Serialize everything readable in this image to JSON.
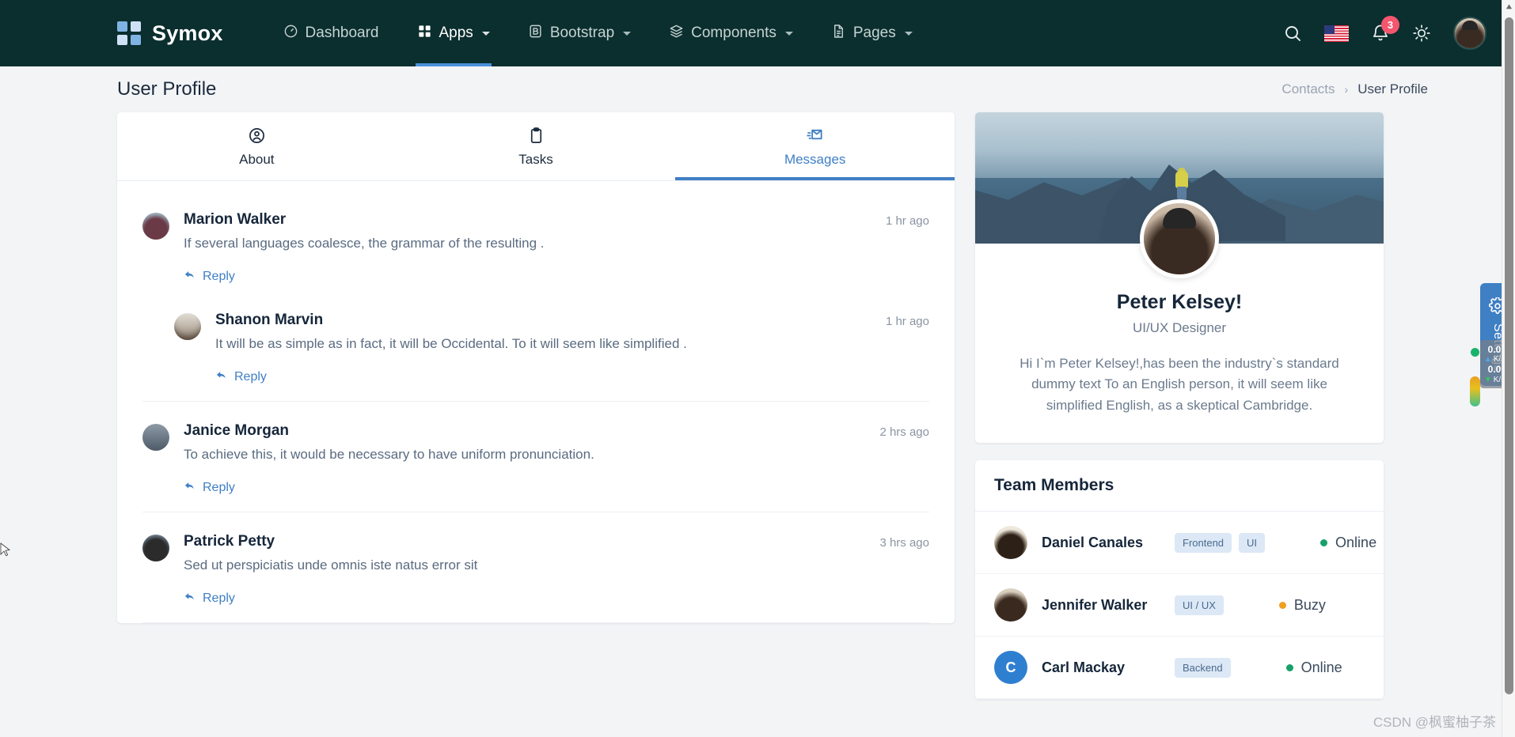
{
  "navbar": {
    "brand": "Symox",
    "links": [
      {
        "label": "Dashboard",
        "icon": "gauge-icon",
        "has_caret": false,
        "active": false
      },
      {
        "label": "Apps",
        "icon": "grid-icon",
        "has_caret": true,
        "active": true
      },
      {
        "label": "Bootstrap",
        "icon": "bootstrap-icon",
        "has_caret": true,
        "active": false
      },
      {
        "label": "Components",
        "icon": "layers-icon",
        "has_caret": true,
        "active": false
      },
      {
        "label": "Pages",
        "icon": "file-icon",
        "has_caret": true,
        "active": false
      }
    ],
    "search_icon": "search-icon",
    "language_flag": "us-flag-icon",
    "notifications_icon": "bell-icon",
    "notifications_count": "3",
    "theme_icon": "sun-icon",
    "avatar": "user-avatar"
  },
  "page": {
    "title": "User Profile",
    "breadcrumb": {
      "parent": "Contacts",
      "separator": "›",
      "current": "User Profile"
    }
  },
  "tabs": [
    {
      "label": "About",
      "icon": "user-circle-icon",
      "active": false
    },
    {
      "label": "Tasks",
      "icon": "clipboard-icon",
      "active": false
    },
    {
      "label": "Messages",
      "icon": "mail-send-icon",
      "active": true
    }
  ],
  "messages": [
    {
      "name": "Marion Walker",
      "time": "1 hr ago",
      "text": "If several languages coalesce, the grammar of the resulting .",
      "reply_label": "Reply",
      "nested": false
    },
    {
      "name": "Shanon Marvin",
      "time": "1 hr ago",
      "text": "It will be as simple as in fact, it will be Occidental. To it will seem like simplified .",
      "reply_label": "Reply",
      "nested": true
    },
    {
      "name": "Janice Morgan",
      "time": "2 hrs ago",
      "text": "To achieve this, it would be necessary to have uniform pronunciation.",
      "reply_label": "Reply",
      "nested": false
    },
    {
      "name": "Patrick Petty",
      "time": "3 hrs ago",
      "text": "Sed ut perspiciatis unde omnis iste natus error sit",
      "reply_label": "Reply",
      "nested": false
    }
  ],
  "profile": {
    "name": "Peter Kelsey!",
    "role": "UI/UX Designer",
    "bio": "Hi I`m Peter Kelsey!,has been the industry`s standard dummy text To an English person, it will seem like simplified English, as a skeptical Cambridge."
  },
  "team": {
    "title": "Team Members",
    "members": [
      {
        "name": "Daniel Canales",
        "tags": [
          "Frontend",
          "UI"
        ],
        "status": "Online",
        "status_color": "#18a06a",
        "initial": ""
      },
      {
        "name": "Jennifer Walker",
        "tags": [
          "UI / UX"
        ],
        "status": "Buzy",
        "status_color": "#f0a020",
        "initial": ""
      },
      {
        "name": "Carl Mackay",
        "tags": [
          "Backend"
        ],
        "status": "Online",
        "status_color": "#18a06a",
        "initial": "C"
      }
    ]
  },
  "settings_tab": {
    "label": "Settings",
    "icon": "gear-icon"
  },
  "netspeed": {
    "upload": "0.0",
    "upload_unit": "K/s",
    "download": "0.0",
    "download_unit": "K/s"
  },
  "watermark": "CSDN @枫蜜柚子茶",
  "colors": {
    "navbar": "#0b2e2e",
    "accent": "#3f7fc4",
    "badge": "#f4566d",
    "page_bg": "#f3f4f6"
  }
}
